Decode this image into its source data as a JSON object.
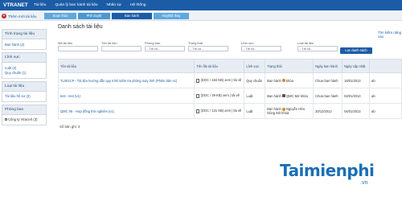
{
  "app": {
    "brand": "VTRANET"
  },
  "topnav": [
    "Tài liệu",
    "Quản lý ban hành tài liệu",
    "Nhân sự",
    "Hệ thống"
  ],
  "toolbar": {
    "new_doc": "Thêm mới tài liệu"
  },
  "steps": [
    {
      "label": "Soạn thảo",
      "color": "#5fa8dc"
    },
    {
      "label": "Phê duyệt",
      "color": "#4a98d2"
    },
    {
      "label": "Ban hành",
      "color": "#1c5ca6"
    },
    {
      "label": "Hủy/Đã thay",
      "color": "#5fa8dc"
    }
  ],
  "sidebar": {
    "status_title": "Tình trạng tài liệu",
    "status_items": [
      "Ban hành (2)"
    ],
    "field_title": "Lĩnh vực",
    "field_items": [
      "Luật (2)",
      "Quy chuẩn (1)"
    ],
    "type_title": "Loại tài liệu",
    "type_items": [
      "Tài liệu hồ sơ (3)"
    ],
    "dept_title": "Phòng ban",
    "dept_items": [
      "Công ty Vtracert (3)"
    ]
  },
  "main": {
    "title": "Danh sách tài liệu",
    "adv_search": "Tìm kiếm nâng cao",
    "search_button": "Lọc danh sách",
    "filters": [
      {
        "label": "Mã tài liệu",
        "value": ""
      },
      {
        "label": "Tên tài liệu",
        "value": ""
      },
      {
        "label": "Phòng ban",
        "value": "- Tất cả -"
      },
      {
        "label": "Trạng thái",
        "value": "- Tất cả -"
      },
      {
        "label": "Lĩnh vực",
        "value": "- Tất cả -"
      },
      {
        "label": "Loại tài liệu",
        "value": "- Tất cả -"
      }
    ],
    "columns": [
      "Tên tài liệu",
      "Tên file tài liệu",
      "Lĩnh vực",
      "Trạng thái",
      "Ngày ban hành",
      "Ngày cập nhật",
      ""
    ],
    "rows": [
      {
        "name": "TL001CP - Tài liệu hướng dẫn quy trình kiểm tra phòng máy tính (Phiên bản v1)",
        "file": "(DOC / 184 KB) xem | tải về",
        "field": "Quy chuẩn",
        "status": "Ban hành",
        "status_extra": "khóa",
        "issued": "Chưa ban hành",
        "updated": "18/01/2013",
        "extra": "ab"
      },
      {
        "name": "test - test (v1)",
        "file": "(DOC / 49 KB) xem | tải về",
        "field": "Luật",
        "status": "Ban hành",
        "status_extra": "QMC Mở khóa",
        "issued": "Chưa ban hành",
        "updated": "04/01/2013",
        "extra": "ab"
      },
      {
        "name": "QMC 06 - Hợp đồng thử nghiệm (v1)",
        "file": "(DOC / 131 KB) xem | tải về",
        "field": "Luật",
        "status": "Ban hành",
        "status_extra": "Nguyễn Hữu Dũng Mở khóa",
        "issued": "20/12/2012",
        "updated": "04/01/2013",
        "extra": "ab"
      }
    ],
    "total_count": "Số bản ghi: 3"
  },
  "watermark": {
    "main": "Taimienphi",
    "tld": ".vn"
  }
}
